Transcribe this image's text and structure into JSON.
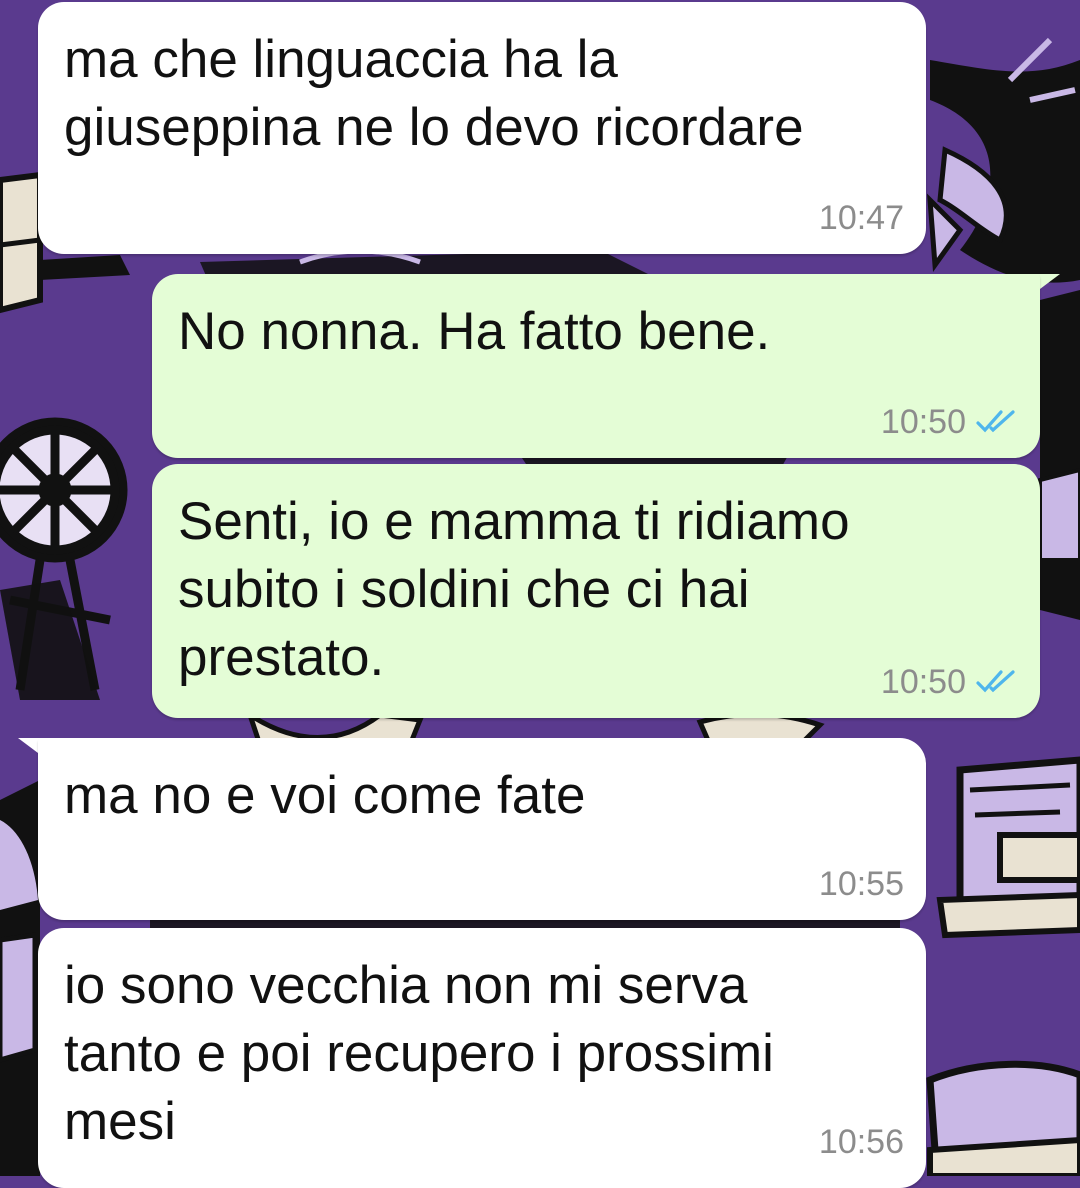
{
  "chat": {
    "messages": [
      {
        "direction": "incoming",
        "text": "ma che linguaccia ha la\ngiuseppina ne lo devo ricordare",
        "time": "10:47",
        "status": ""
      },
      {
        "direction": "outgoing",
        "text": "No nonna. Ha fatto bene.",
        "time": "10:50",
        "status": "read"
      },
      {
        "direction": "outgoing",
        "text": "Senti, io e mamma ti ridiamo\nsubito i soldini che ci hai\nprestato.",
        "time": "10:50",
        "status": "read"
      },
      {
        "direction": "incoming",
        "text": "ma no e voi come fate",
        "time": "10:55",
        "status": ""
      },
      {
        "direction": "incoming",
        "text": "io sono vecchia non mi serva\ntanto e poi recupero i prossimi\nmesi",
        "time": "10:56",
        "status": ""
      }
    ]
  },
  "icons": {
    "read_receipt": "double-check-icon"
  },
  "colors": {
    "wallpaper": "#5a3a8e",
    "incoming_bubble": "#ffffff",
    "outgoing_bubble": "#e4fdd6",
    "timestamp": "#8c8c8c",
    "read_ticks": "#4fb6ec"
  }
}
